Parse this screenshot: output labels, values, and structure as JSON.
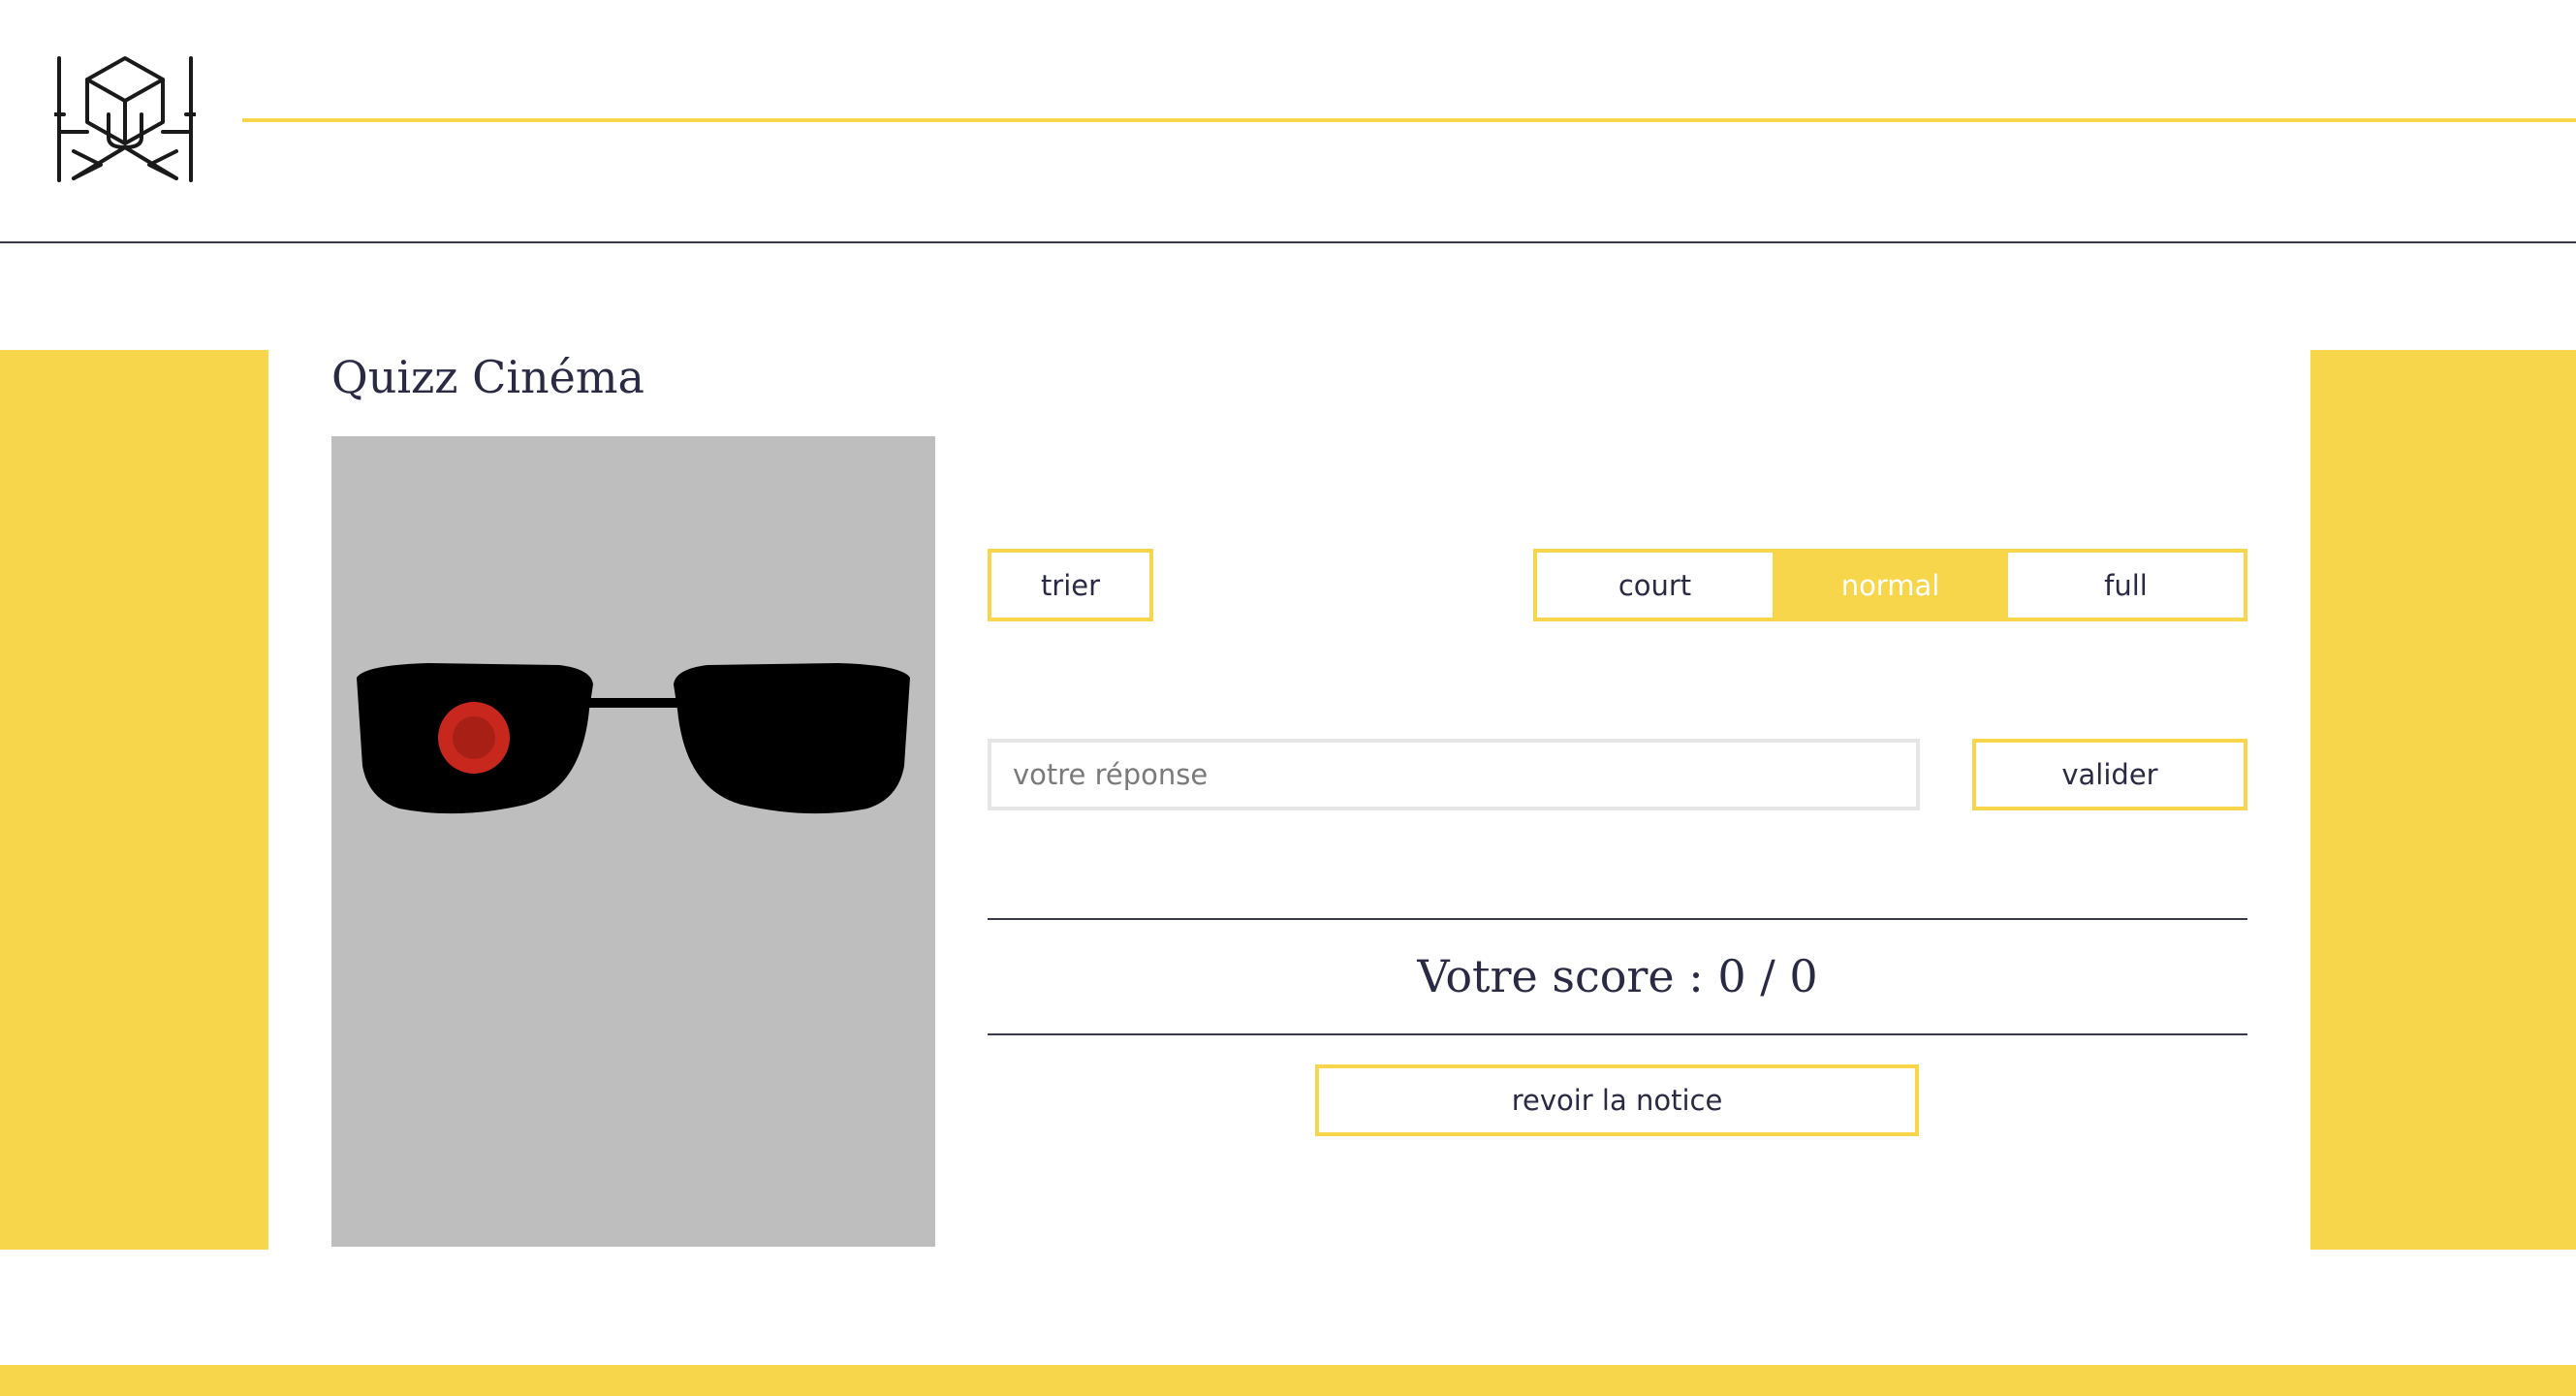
{
  "colors": {
    "accent": "#f8d64c",
    "text": "#2a2a45",
    "poster_background": "#bebebe"
  },
  "header": {
    "logo_icon": "hexagon-monogram-logo"
  },
  "quiz": {
    "title": "Quizz Cinéma",
    "poster": {
      "icon": "sunglasses-red-eye-icon"
    },
    "sort_label": "trier",
    "length_options": [
      "court",
      "normal",
      "full"
    ],
    "selected_length": "normal",
    "answer": {
      "value": "",
      "placeholder": "votre réponse"
    },
    "submit_label": "valider",
    "score_text": "Votre score : 0 / 0",
    "notice_label": "revoir la notice"
  }
}
